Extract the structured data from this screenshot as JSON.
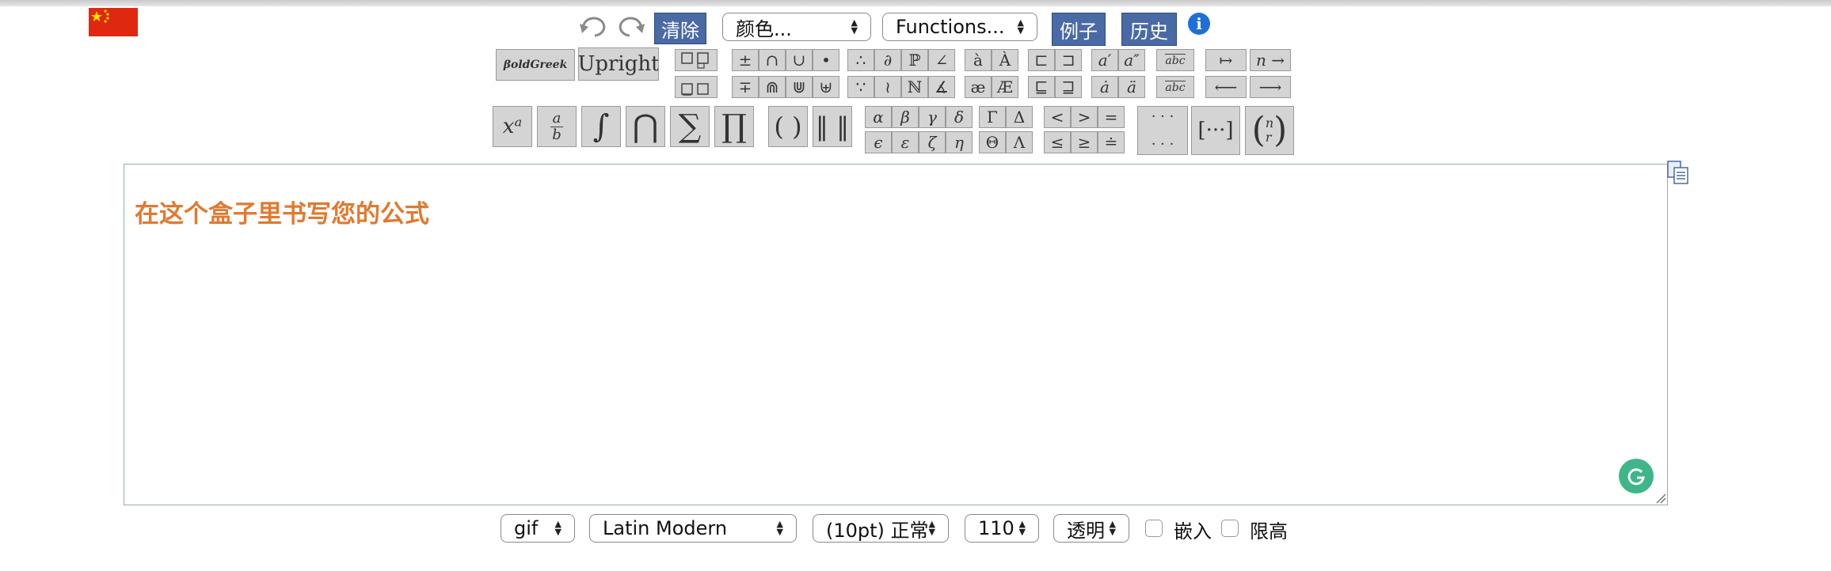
{
  "toolbar": {
    "clear_label": "清除",
    "color_select": "颜色...",
    "functions_select": "Functions...",
    "examples_label": "例子",
    "history_label": "历史",
    "info_glyph": "i"
  },
  "styles": {
    "boldgreek": "βoldGreek",
    "upright": "Upright"
  },
  "symbols": {
    "row1": {
      "pm": "±",
      "cap": "∩",
      "cup": "∪",
      "bullet": "•",
      "therefore": "∴",
      "partial": "∂",
      "pp": "ℙ",
      "angle": "∠",
      "acc_a": "à",
      "acc_A": "À",
      "sqsub": "⊏",
      "sqsup": "⊐",
      "prime1": "a′",
      "prime2": "a″",
      "widetilde": "abc",
      "mapsto": "↦",
      "n_to": "n →"
    },
    "row2": {
      "mp": "∓",
      "capcap": "⋒",
      "cupcup": "⋓",
      "uplus": "⊎",
      "because": "∵",
      "wr": "≀",
      "nn": "ℕ",
      "sphang": "∡",
      "ae": "æ",
      "AE": "Æ",
      "sqsubeq": "⊑",
      "sqsupeq": "⊒",
      "dot_a": "ȧ",
      "ddot_a": "ä",
      "widehat": "abc",
      "leftarrow": "⟵",
      "rightarrow": "⟶"
    },
    "big": {
      "sup": "xᵃ",
      "frac_num": "a",
      "frac_den": "b",
      "integral": "∫",
      "bigcap": "⋂",
      "sum": "∑",
      "prod": "∏",
      "paren": "( )",
      "norm": "‖ ‖",
      "dots_h": "· · ·",
      "dots_h2": "· · ·",
      "matrix": "[···]",
      "binom_n": "n",
      "binom_r": "r"
    },
    "greek": {
      "alpha": "α",
      "beta": "β",
      "gamma": "γ",
      "delta": "δ",
      "Gamma": "Γ",
      "Delta": "Δ",
      "epsilon": "ϵ",
      "varepsilon": "ε",
      "zeta": "ζ",
      "eta": "η",
      "Theta": "Θ",
      "Lambda": "Λ"
    },
    "rel": {
      "lt": "<",
      "gt": ">",
      "eq": "=",
      "le": "≤",
      "ge": "≥",
      "doteq": "≐"
    }
  },
  "editor": {
    "placeholder": "在这个盒子里书写您的公式"
  },
  "bottom": {
    "format": "gif",
    "font": "Latin Modern",
    "size": "(10pt) 正常",
    "dpi": "110",
    "background": "透明",
    "inline_label": "嵌入",
    "compressed_label": "限高"
  },
  "colors": {
    "accent_blue": "#4a6aa5",
    "placeholder_orange": "#e07a30",
    "flag_red": "#de2910",
    "grammarly_green": "#3fb58a"
  }
}
